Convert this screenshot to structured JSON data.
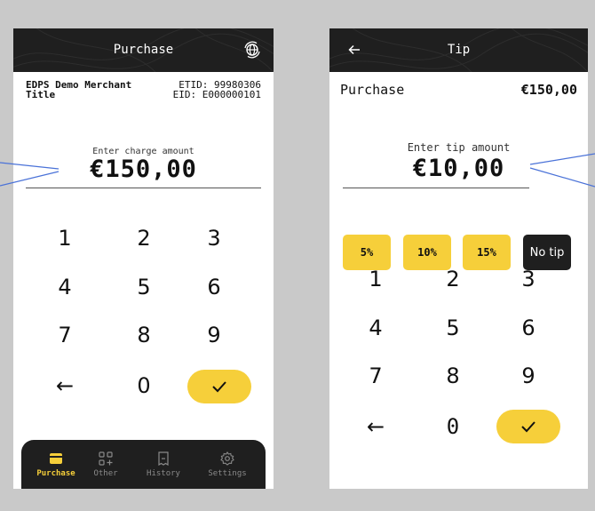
{
  "left": {
    "header": {
      "title": "Purchase",
      "action_icon": "globe-refresh-icon"
    },
    "merchant": {
      "name": "EDPS Demo Merchant",
      "title": "Title",
      "etid": "ETID: 99980306",
      "eid": "EID: E000000101"
    },
    "amount": {
      "label": "Enter charge amount",
      "value": "€150,00"
    },
    "keypad": [
      "1",
      "2",
      "3",
      "4",
      "5",
      "6",
      "7",
      "8",
      "9",
      "←",
      "0"
    ],
    "nav": [
      {
        "label": "Purchase",
        "icon": "card-icon",
        "active": true
      },
      {
        "label": "Other",
        "icon": "grid-plus-icon",
        "active": false
      },
      {
        "label": "History",
        "icon": "receipt-icon",
        "active": false
      },
      {
        "label": "Settings",
        "icon": "gear-icon",
        "active": false
      }
    ]
  },
  "right": {
    "header": {
      "title": "Tip",
      "back_icon": "back-arrow-icon"
    },
    "purchase": {
      "label": "Purchase",
      "value": "€150,00"
    },
    "amount": {
      "label": "Enter tip amount",
      "value": "€10,00"
    },
    "tips": [
      "5%",
      "10%",
      "15%",
      "No tip"
    ],
    "keypad": [
      "1",
      "2",
      "3",
      "4",
      "5",
      "6",
      "7",
      "8",
      "9",
      "←",
      "0"
    ]
  },
  "colors": {
    "accent": "#f6cf3a",
    "dark": "#1f1f1f",
    "background": "#c9c9c9",
    "callout": "#4a72d8"
  }
}
